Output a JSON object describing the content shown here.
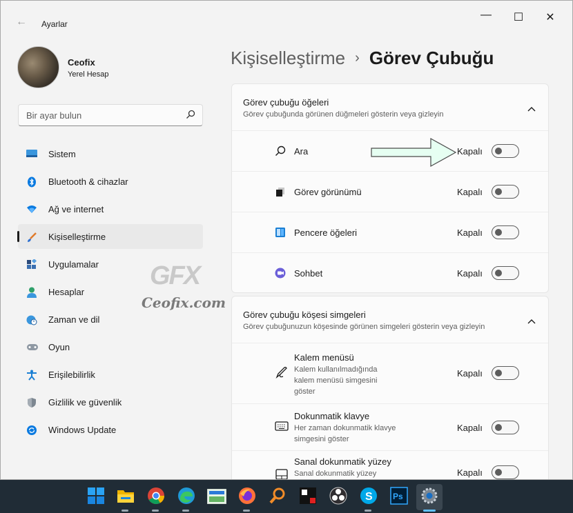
{
  "app": {
    "title": "Ayarlar"
  },
  "window_controls": {
    "minimize": "—",
    "maximize": "☐",
    "close": "✕"
  },
  "user": {
    "name": "Ceofix",
    "account": "Yerel Hesap"
  },
  "search": {
    "placeholder": "Bir ayar bulun"
  },
  "nav": [
    {
      "label": "Sistem",
      "icon": "monitor-icon"
    },
    {
      "label": "Bluetooth & cihazlar",
      "icon": "bluetooth-icon"
    },
    {
      "label": "Ağ ve internet",
      "icon": "wifi-icon"
    },
    {
      "label": "Kişiselleştirme",
      "icon": "brush-icon",
      "active": true
    },
    {
      "label": "Uygulamalar",
      "icon": "apps-icon"
    },
    {
      "label": "Hesaplar",
      "icon": "account-icon"
    },
    {
      "label": "Zaman ve dil",
      "icon": "clock-globe-icon"
    },
    {
      "label": "Oyun",
      "icon": "gamepad-icon"
    },
    {
      "label": "Erişilebilirlik",
      "icon": "accessibility-icon"
    },
    {
      "label": "Gizlilik ve güvenlik",
      "icon": "shield-icon"
    },
    {
      "label": "Windows Update",
      "icon": "update-icon"
    }
  ],
  "breadcrumb": {
    "parent": "Kişiselleştirme",
    "separator": "›",
    "current": "Görev Çubuğu"
  },
  "section1": {
    "title": "Görev çubuğu öğeleri",
    "subtitle": "Görev çubuğunda görünen düğmeleri gösterin veya gizleyin",
    "rows": [
      {
        "label": "Ara",
        "status": "Kapalı",
        "icon": "search-icon",
        "enabled": false
      },
      {
        "label": "Görev görünümü",
        "status": "Kapalı",
        "icon": "task-view-icon",
        "enabled": false
      },
      {
        "label": "Pencere öğeleri",
        "status": "Kapalı",
        "icon": "widgets-icon",
        "enabled": false
      },
      {
        "label": "Sohbet",
        "status": "Kapalı",
        "icon": "chat-icon",
        "enabled": false
      }
    ]
  },
  "section2": {
    "title": "Görev çubuğu köşesi simgeleri",
    "subtitle": "Görev çubuğunuzun köşesinde görünen simgeleri gösterin veya gizleyin",
    "rows": [
      {
        "label": "Kalem menüsü",
        "desc": "Kalem kullanılmadığında kalem menüsü simgesini göster",
        "status": "Kapalı",
        "icon": "pen-icon",
        "enabled": false
      },
      {
        "label": "Dokunmatik klavye",
        "desc": "Her zaman dokunmatik klavye simgesini göster",
        "status": "Kapalı",
        "icon": "keyboard-icon",
        "enabled": false
      },
      {
        "label": "Sanal dokunmatik yüzey",
        "desc": "Sanal dokunmatik yüzey",
        "status": "Kapalı",
        "icon": "touchpad-icon",
        "enabled": false
      }
    ]
  },
  "watermark": {
    "logo": "GFX",
    "site": "Ceofix.com"
  },
  "taskbar": [
    "windows-start-icon",
    "file-explorer-icon",
    "chrome-icon",
    "edge-icon",
    "ftp-icon",
    "firefox-icon",
    "search-app-icon",
    "app-icon",
    "obs-icon",
    "skype-icon",
    "photoshop-icon",
    "settings-icon"
  ],
  "colors": {
    "accent": "#0067c0",
    "arrow_fill": "#e6fff2",
    "taskbar": "#202c36"
  }
}
